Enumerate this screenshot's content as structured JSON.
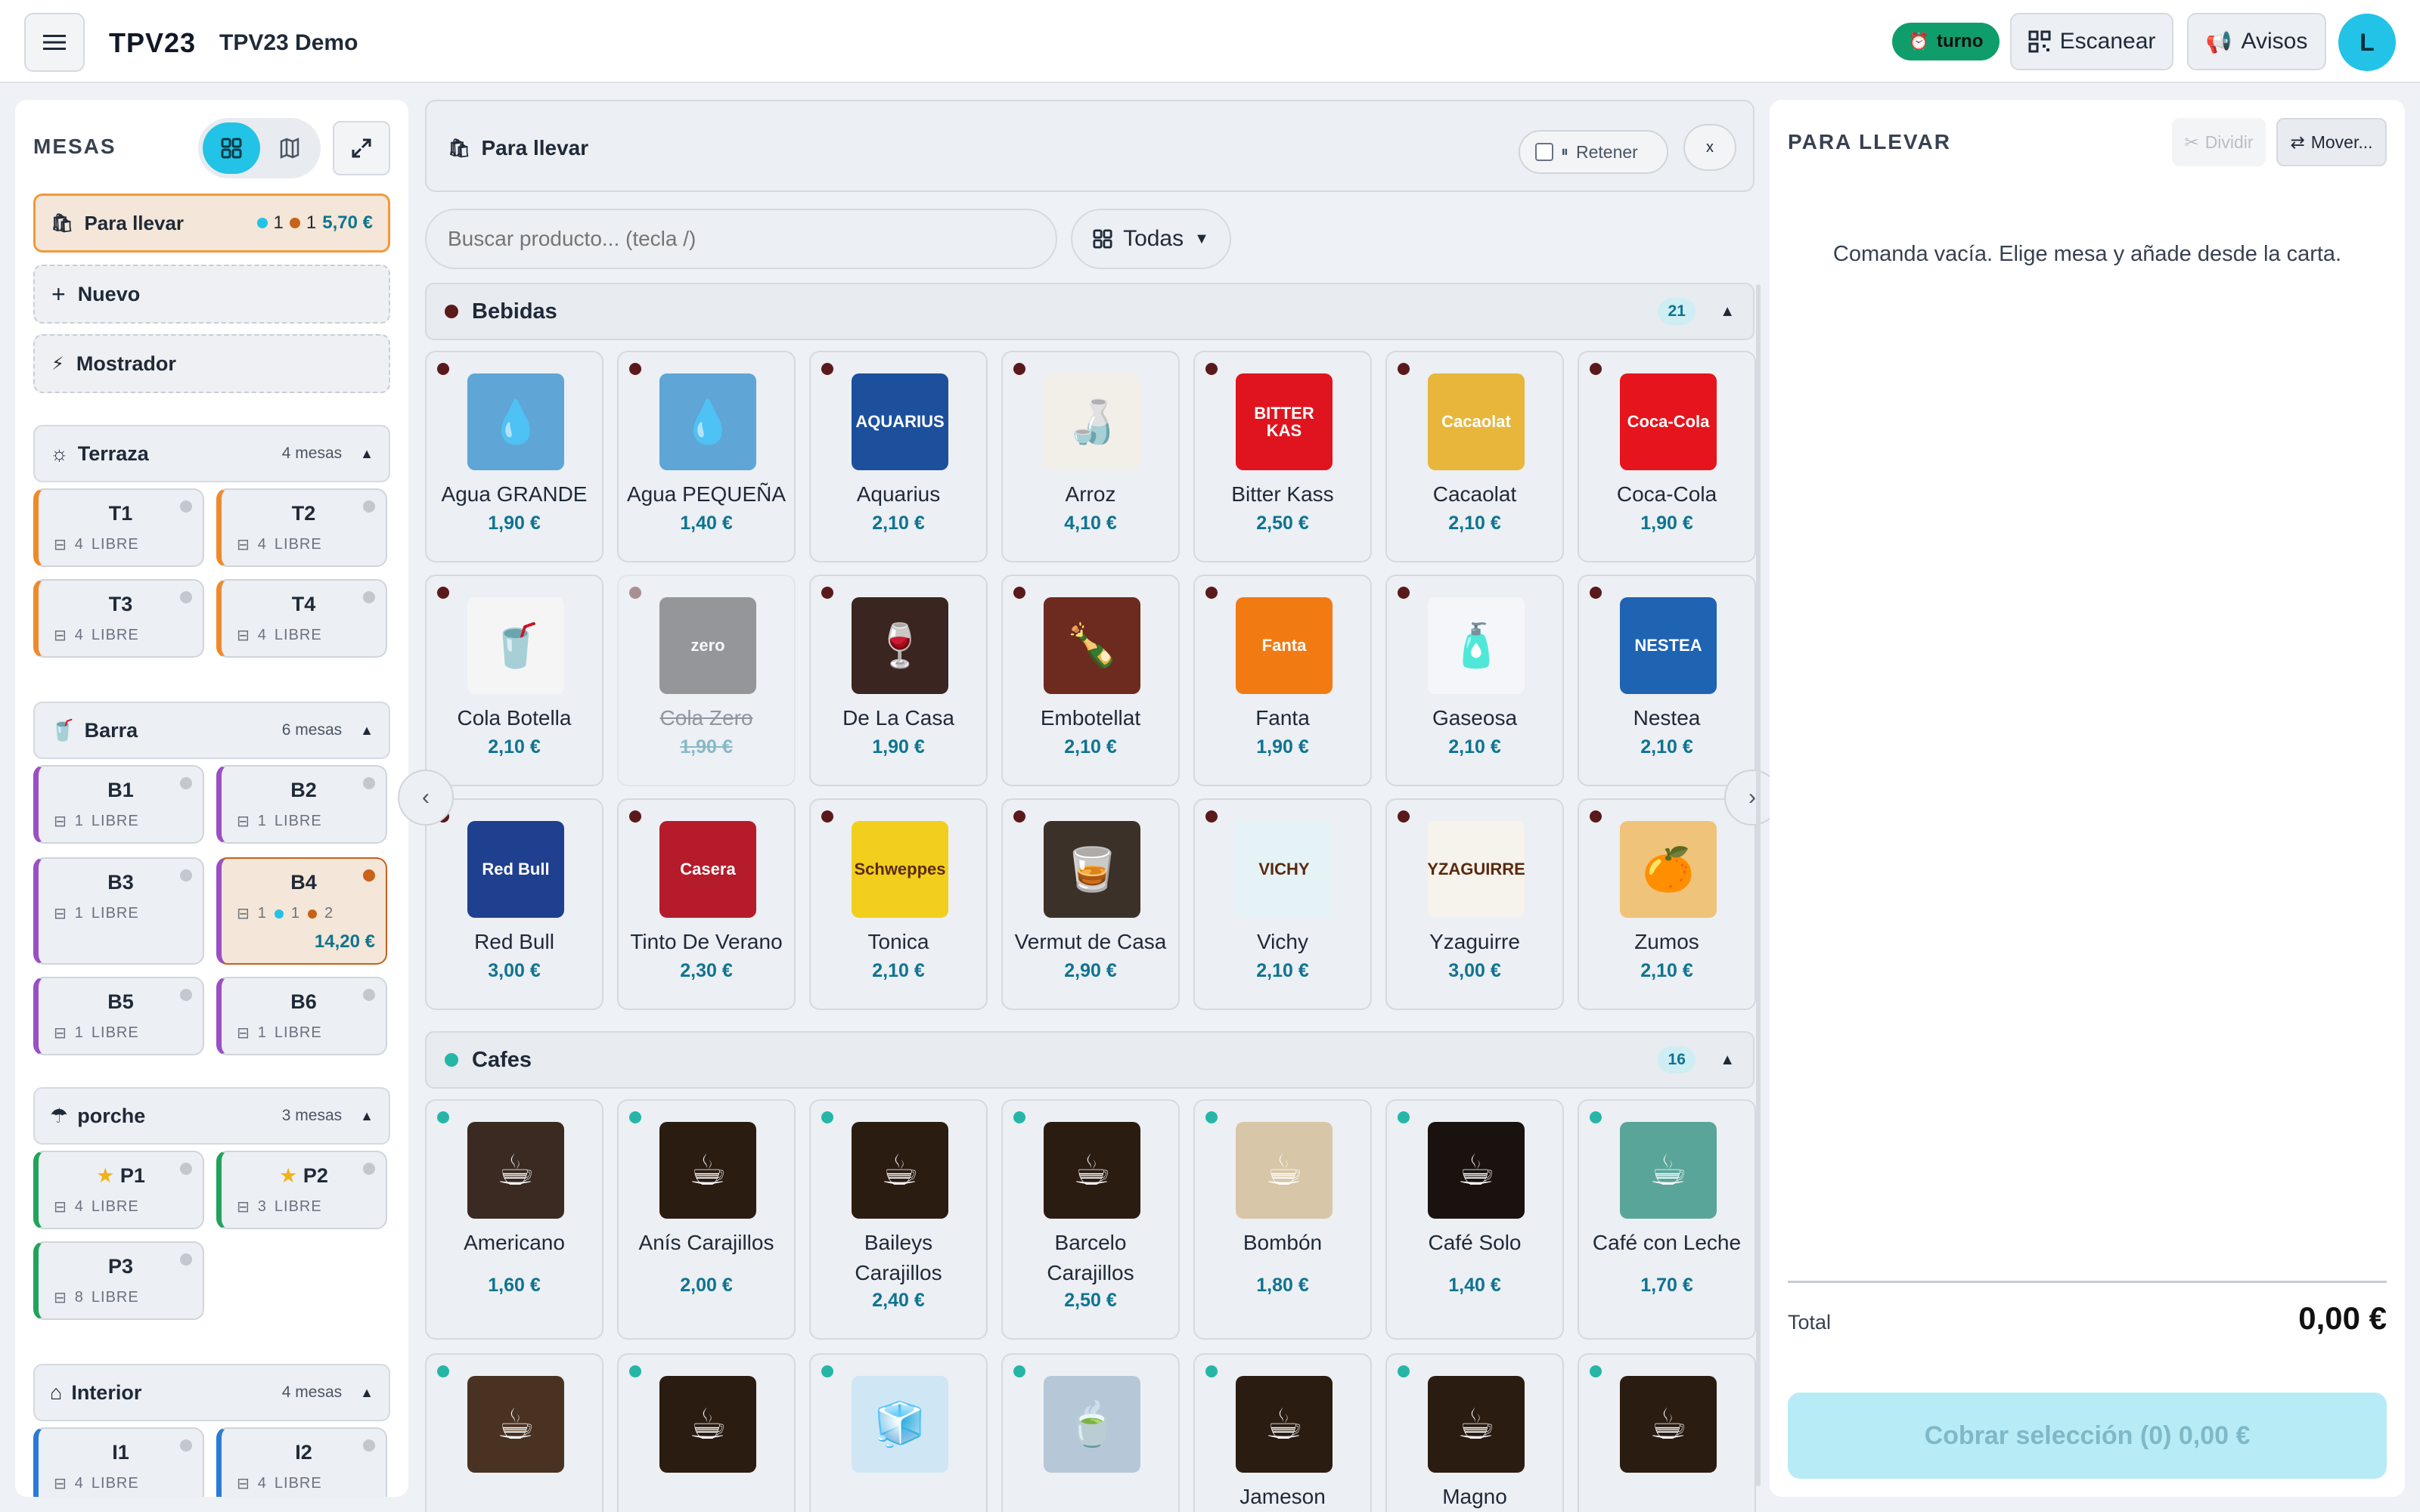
{
  "topbar": {
    "brand": "TPV23",
    "app_name": "TPV23 Demo",
    "turno": "turno",
    "scan": "Escanear",
    "alerts": "Avisos",
    "avatar": "L"
  },
  "left": {
    "title": "MESAS",
    "para_llevar": {
      "label": "Para llevar",
      "count_a": "1",
      "count_b": "1",
      "amount": "5,70 €"
    },
    "nuevo": "Nuevo",
    "mostrador": "Mostrador",
    "zones": [
      {
        "name": "Terraza",
        "count": "4 mesas",
        "color": "#ef8a2c",
        "tables": [
          {
            "name": "T1",
            "seats": "4",
            "status": "LIBRE"
          },
          {
            "name": "T2",
            "seats": "4",
            "status": "LIBRE"
          },
          {
            "name": "T3",
            "seats": "4",
            "status": "LIBRE"
          },
          {
            "name": "T4",
            "seats": "4",
            "status": "LIBRE"
          }
        ]
      },
      {
        "name": "Barra",
        "count": "6 mesas",
        "color": "#9b4fc4",
        "tables": [
          {
            "name": "B1",
            "seats": "1",
            "status": "LIBRE"
          },
          {
            "name": "B2",
            "seats": "1",
            "status": "LIBRE"
          },
          {
            "name": "B3",
            "seats": "1",
            "status": "LIBRE"
          },
          {
            "name": "B4",
            "seats": "1",
            "a": "1",
            "b": "2",
            "amount": "14,20 €"
          },
          {
            "name": "B5",
            "seats": "1",
            "status": "LIBRE"
          },
          {
            "name": "B6",
            "seats": "1",
            "status": "LIBRE"
          }
        ]
      },
      {
        "name": "porche",
        "count": "3 mesas",
        "color": "#22a35a",
        "tables": [
          {
            "name": "P1",
            "seats": "4",
            "status": "LIBRE"
          },
          {
            "name": "P2",
            "seats": "3",
            "status": "LIBRE"
          },
          {
            "name": "P3",
            "seats": "8",
            "status": "LIBRE"
          }
        ]
      },
      {
        "name": "Interior",
        "count": "4 mesas",
        "color": "#2b7bd6",
        "tables": [
          {
            "name": "I1",
            "seats": "4",
            "status": "LIBRE"
          },
          {
            "name": "I2",
            "seats": "4",
            "status": "LIBRE"
          }
        ]
      }
    ]
  },
  "center": {
    "title": "Para llevar",
    "retener": "Retener",
    "close": "x",
    "search_placeholder": "Buscar producto... (tecla /)",
    "category_select": "Todas",
    "categories": [
      {
        "name": "Bebidas",
        "count": "21",
        "dot": "#5a1a1a",
        "products": [
          {
            "name": "Agua GRANDE",
            "price": "1,90 €",
            "bg": "#5fa5d6",
            "label": "💧"
          },
          {
            "name": "Agua PEQUEÑA",
            "price": "1,40 €",
            "bg": "#5fa5d6",
            "label": "💧"
          },
          {
            "name": "Aquarius",
            "price": "2,10 €",
            "bg": "#1c4f9c",
            "label": "AQUARIUS"
          },
          {
            "name": "Arroz",
            "price": "4,10 €",
            "bg": "#f2efe8",
            "label": "🍶"
          },
          {
            "name": "Bitter Kass",
            "price": "2,50 €",
            "bg": "#e0141e",
            "label": "BITTER KAS"
          },
          {
            "name": "Cacaolat",
            "price": "2,10 €",
            "bg": "#e7b63b",
            "label": "Cacaolat"
          },
          {
            "name": "Coca-Cola",
            "price": "1,90 €",
            "bg": "#e5141d",
            "label": "Coca-Cola"
          },
          {
            "name": "Cola Botella",
            "price": "2,10 €",
            "bg": "#f5f5f5",
            "label": "🥤"
          },
          {
            "name": "Cola Zero",
            "price": "1,90 €",
            "bg": "#2a2a2a",
            "label": "zero",
            "disabled": true
          },
          {
            "name": "De La Casa",
            "price": "1,90 €",
            "bg": "#3a2520",
            "label": "🍷"
          },
          {
            "name": "Embotellat",
            "price": "2,10 €",
            "bg": "#6d2a1e",
            "label": "🍾"
          },
          {
            "name": "Fanta",
            "price": "1,90 €",
            "bg": "#f27a12",
            "label": "Fanta"
          },
          {
            "name": "Gaseosa",
            "price": "2,10 €",
            "bg": "#f4f6fa",
            "label": "🧴"
          },
          {
            "name": "Nestea",
            "price": "2,10 €",
            "bg": "#1f63b3",
            "label": "NESTEA"
          },
          {
            "name": "Red Bull",
            "price": "3,00 €",
            "bg": "#1f3f8f",
            "label": "Red Bull"
          },
          {
            "name": "Tinto De Verano",
            "price": "2,30 €",
            "bg": "#b51b2a",
            "label": "Casera"
          },
          {
            "name": "Tonica",
            "price": "2,10 €",
            "bg": "#f2cf1c",
            "label": "Schweppes"
          },
          {
            "name": "Vermut de Casa",
            "price": "2,90 €",
            "bg": "#3c3128",
            "label": "🥃"
          },
          {
            "name": "Vichy",
            "price": "2,10 €",
            "bg": "#e6f3f6",
            "label": "VICHY"
          },
          {
            "name": "Yzaguirre",
            "price": "3,00 €",
            "bg": "#f6f3ec",
            "label": "YZAGUIRRE"
          },
          {
            "name": "Zumos",
            "price": "2,10 €",
            "bg": "#f0c37a",
            "label": "🍊"
          }
        ]
      },
      {
        "name": "Cafes",
        "count": "16",
        "dot": "#26b6a8",
        "products": [
          {
            "name": "Americano",
            "price": "1,60 €",
            "bg": "#3a2a22",
            "label": "☕"
          },
          {
            "name": "Anís Carajillos",
            "price": "2,00 €",
            "bg": "#2b1c12",
            "label": "☕"
          },
          {
            "name": "Baileys Carajillos",
            "price": "2,40 €",
            "bg": "#2b1c12",
            "label": "☕"
          },
          {
            "name": "Barcelo Carajillos",
            "price": "2,50 €",
            "bg": "#2b1c12",
            "label": "☕"
          },
          {
            "name": "Bombón",
            "price": "1,80 €",
            "bg": "#d8c6a8",
            "label": "☕"
          },
          {
            "name": "Café Solo",
            "price": "1,40 €",
            "bg": "#1a120e",
            "label": "☕"
          },
          {
            "name": "Café con Leche",
            "price": "1,70 €",
            "bg": "#5aa59a",
            "label": "☕"
          },
          {
            "name": "",
            "price": "",
            "bg": "#4a3222",
            "label": "☕"
          },
          {
            "name": "",
            "price": "",
            "bg": "#2b1c12",
            "label": "☕"
          },
          {
            "name": "",
            "price": "",
            "bg": "#cfe6f4",
            "label": "🧊"
          },
          {
            "name": "",
            "price": "",
            "bg": "#b6c8d8",
            "label": "🍵"
          },
          {
            "name": "Jameson",
            "price": "",
            "bg": "#2b1c12",
            "label": "☕"
          },
          {
            "name": "Magno",
            "price": "",
            "bg": "#2b1c12",
            "label": "☕"
          },
          {
            "name": "",
            "price": "",
            "bg": "#2b1c12",
            "label": "☕"
          }
        ]
      }
    ]
  },
  "right": {
    "title": "PARA LLEVAR",
    "dividir": "Dividir",
    "mover": "Mover...",
    "empty_msg": "Comanda vacía. Elige mesa y añade desde la carta.",
    "total_label": "Total",
    "total_value": "0,00 €",
    "cobrar": "Cobrar selección (0) 0,00 €"
  }
}
